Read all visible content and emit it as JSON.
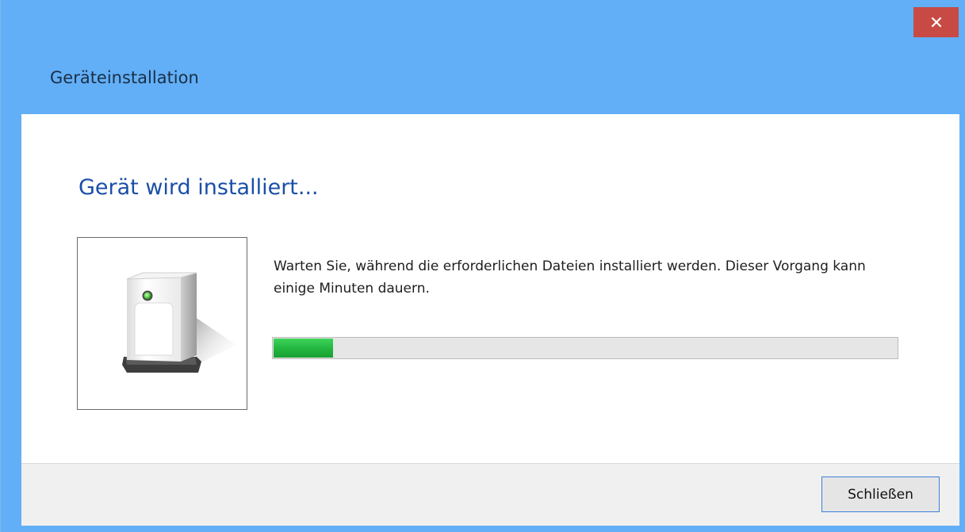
{
  "window": {
    "title": "Geräteinstallation",
    "close_icon": "close-icon",
    "frame_color": "#62aff8"
  },
  "main": {
    "heading": "Gerät wird installiert...",
    "heading_color": "#1a4fa8",
    "device_icon": "device-icon",
    "message": "Warten Sie, während die erforderlichen Dateien installiert werden. Dieser Vorgang kann einige Minuten dauern.",
    "progress_fraction": 0.095,
    "progress_color": "#22b53f"
  },
  "footer": {
    "close_label": "Schließen"
  }
}
